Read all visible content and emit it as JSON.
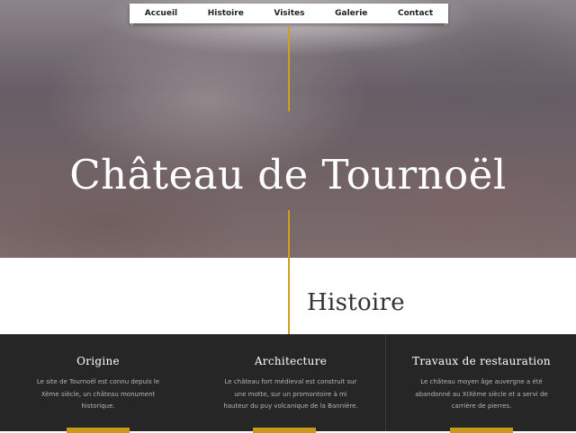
{
  "nav": {
    "items": [
      {
        "label": "Accueil"
      },
      {
        "label": "Histoire"
      },
      {
        "label": "Visites"
      },
      {
        "label": "Galerie"
      },
      {
        "label": "Contact"
      }
    ]
  },
  "hero": {
    "title": "Château de Tournoël"
  },
  "section": {
    "title": "Histoire"
  },
  "columns": [
    {
      "title": "Origine",
      "text": "Le site de Tournoël est connu depuis le Xème siècle, un château monument historique."
    },
    {
      "title": "Architecture",
      "text": "Le château fort médieval est construit sur une motte, sur un promontoire à mi hauteur du puy volcanique de la Bannière."
    },
    {
      "title": "Travaux de restauration",
      "text": "Le château moyen âge auvergne a été abandonné au XIXème siècle et a servi de carrière de pierres."
    }
  ],
  "colors": {
    "accent": "#d4a017",
    "band": "#262626"
  }
}
